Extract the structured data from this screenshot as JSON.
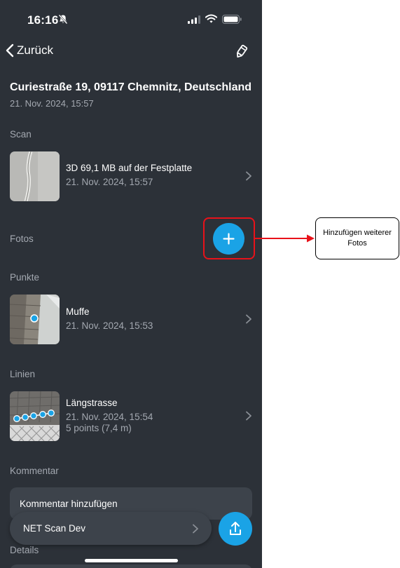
{
  "status_bar": {
    "time": "16:16"
  },
  "nav": {
    "back_label": "Zurück"
  },
  "header": {
    "address": "Curiestraße 19, 09117 Chemnitz, Deutschland",
    "date": "21. Nov. 2024, 15:57"
  },
  "scan": {
    "section_label": "Scan",
    "title": "3D 69,1 MB auf der Festplatte",
    "date": "21. Nov. 2024, 15:57"
  },
  "fotos": {
    "section_label": "Fotos"
  },
  "punkte": {
    "section_label": "Punkte",
    "items": [
      {
        "title": "Muffe",
        "date": "21. Nov. 2024, 15:53"
      }
    ]
  },
  "linien": {
    "section_label": "Linien",
    "items": [
      {
        "title": "Längstrasse",
        "date": "21. Nov. 2024, 15:54",
        "details": "5 points (7,4 m)"
      }
    ]
  },
  "kommentar": {
    "section_label": "Kommentar",
    "placeholder": "Kommentar hinzufügen"
  },
  "footer": {
    "device_label": "NET Scan Dev",
    "details_label": "Details"
  },
  "annotation": {
    "text_line1": "Hinzufügen weiterer",
    "text_line2": "Fotos"
  },
  "colors": {
    "background": "#2c3138",
    "card": "#3d434b",
    "accent": "#1aa3e6",
    "highlight": "#e8121a",
    "secondary_text": "#a3a8b0"
  },
  "icons": [
    "bell-slash-icon",
    "signal-icon",
    "wifi-icon",
    "battery-icon",
    "chevron-left-icon",
    "edit-icon",
    "chevron-right-icon",
    "plus-icon",
    "upload-icon"
  ]
}
